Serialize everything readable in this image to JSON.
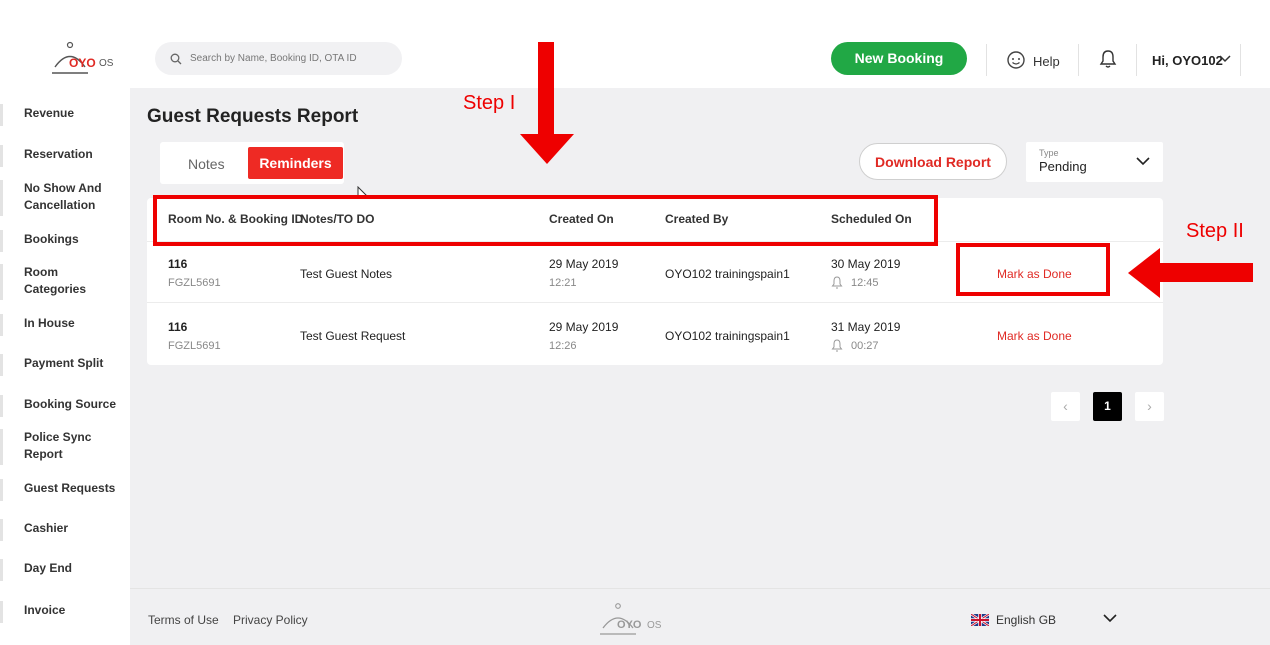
{
  "header": {
    "logo_text": "OYO",
    "logo_suffix": "OS",
    "search_placeholder": "Search by Name, Booking ID, OTA ID",
    "new_booking": "New Booking",
    "help": "Help",
    "user": "Hi, OYO102"
  },
  "sidebar": {
    "items": [
      {
        "label": "Revenue"
      },
      {
        "label": "Reservation"
      },
      {
        "label": "No Show And Cancellation"
      },
      {
        "label": "Bookings"
      },
      {
        "label": "Room Categories"
      },
      {
        "label": "In House"
      },
      {
        "label": "Payment Split"
      },
      {
        "label": "Booking Source"
      },
      {
        "label": "Police Sync Report"
      },
      {
        "label": "Guest Requests"
      },
      {
        "label": "Cashier"
      },
      {
        "label": "Day End"
      },
      {
        "label": "Invoice"
      }
    ]
  },
  "main": {
    "title": "Guest Requests Report",
    "tabs": [
      {
        "label": "Notes"
      },
      {
        "label": "Reminders"
      }
    ],
    "download": "Download Report",
    "type_label": "Type",
    "type_value": "Pending",
    "columns": [
      "Room No. & Booking ID",
      "Notes/TO DO",
      "Created On",
      "Created By",
      "Scheduled On"
    ],
    "rows": [
      {
        "room": "116",
        "booking_id": "FGZL5691",
        "note": "Test Guest Notes",
        "created_date": "29 May 2019",
        "created_time": "12:21",
        "created_by": "OYO102 trainingspain1",
        "sched_date": "30 May 2019",
        "sched_time": "12:45",
        "action": "Mark as Done"
      },
      {
        "room": "116",
        "booking_id": "FGZL5691",
        "note": "Test Guest Request",
        "created_date": "29 May 2019",
        "created_time": "12:26",
        "created_by": "OYO102 trainingspain1",
        "sched_date": "31 May 2019",
        "sched_time": "00:27",
        "action": "Mark as Done"
      }
    ],
    "page": "1"
  },
  "footer": {
    "terms": "Terms of Use",
    "privacy": "Privacy Policy",
    "language": "English GB"
  },
  "annotations": {
    "step1": "Step I",
    "step2": "Step II",
    "color": "#ee0000"
  }
}
